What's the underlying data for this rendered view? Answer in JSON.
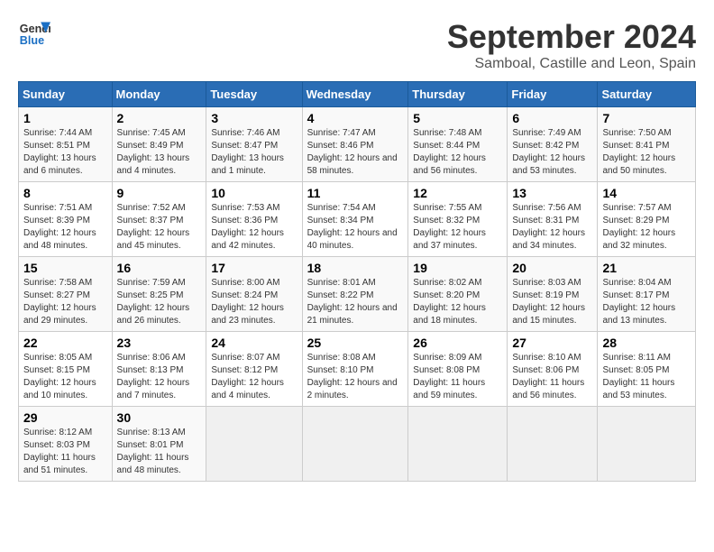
{
  "logo": {
    "line1": "General",
    "line2": "Blue"
  },
  "title": "September 2024",
  "subtitle": "Samboal, Castille and Leon, Spain",
  "weekdays": [
    "Sunday",
    "Monday",
    "Tuesday",
    "Wednesday",
    "Thursday",
    "Friday",
    "Saturday"
  ],
  "weeks": [
    [
      {
        "day": "1",
        "sunrise": "7:44 AM",
        "sunset": "8:51 PM",
        "daylight": "13 hours and 6 minutes."
      },
      {
        "day": "2",
        "sunrise": "7:45 AM",
        "sunset": "8:49 PM",
        "daylight": "13 hours and 4 minutes."
      },
      {
        "day": "3",
        "sunrise": "7:46 AM",
        "sunset": "8:47 PM",
        "daylight": "13 hours and 1 minute."
      },
      {
        "day": "4",
        "sunrise": "7:47 AM",
        "sunset": "8:46 PM",
        "daylight": "12 hours and 58 minutes."
      },
      {
        "day": "5",
        "sunrise": "7:48 AM",
        "sunset": "8:44 PM",
        "daylight": "12 hours and 56 minutes."
      },
      {
        "day": "6",
        "sunrise": "7:49 AM",
        "sunset": "8:42 PM",
        "daylight": "12 hours and 53 minutes."
      },
      {
        "day": "7",
        "sunrise": "7:50 AM",
        "sunset": "8:41 PM",
        "daylight": "12 hours and 50 minutes."
      }
    ],
    [
      {
        "day": "8",
        "sunrise": "7:51 AM",
        "sunset": "8:39 PM",
        "daylight": "12 hours and 48 minutes."
      },
      {
        "day": "9",
        "sunrise": "7:52 AM",
        "sunset": "8:37 PM",
        "daylight": "12 hours and 45 minutes."
      },
      {
        "day": "10",
        "sunrise": "7:53 AM",
        "sunset": "8:36 PM",
        "daylight": "12 hours and 42 minutes."
      },
      {
        "day": "11",
        "sunrise": "7:54 AM",
        "sunset": "8:34 PM",
        "daylight": "12 hours and 40 minutes."
      },
      {
        "day": "12",
        "sunrise": "7:55 AM",
        "sunset": "8:32 PM",
        "daylight": "12 hours and 37 minutes."
      },
      {
        "day": "13",
        "sunrise": "7:56 AM",
        "sunset": "8:31 PM",
        "daylight": "12 hours and 34 minutes."
      },
      {
        "day": "14",
        "sunrise": "7:57 AM",
        "sunset": "8:29 PM",
        "daylight": "12 hours and 32 minutes."
      }
    ],
    [
      {
        "day": "15",
        "sunrise": "7:58 AM",
        "sunset": "8:27 PM",
        "daylight": "12 hours and 29 minutes."
      },
      {
        "day": "16",
        "sunrise": "7:59 AM",
        "sunset": "8:25 PM",
        "daylight": "12 hours and 26 minutes."
      },
      {
        "day": "17",
        "sunrise": "8:00 AM",
        "sunset": "8:24 PM",
        "daylight": "12 hours and 23 minutes."
      },
      {
        "day": "18",
        "sunrise": "8:01 AM",
        "sunset": "8:22 PM",
        "daylight": "12 hours and 21 minutes."
      },
      {
        "day": "19",
        "sunrise": "8:02 AM",
        "sunset": "8:20 PM",
        "daylight": "12 hours and 18 minutes."
      },
      {
        "day": "20",
        "sunrise": "8:03 AM",
        "sunset": "8:19 PM",
        "daylight": "12 hours and 15 minutes."
      },
      {
        "day": "21",
        "sunrise": "8:04 AM",
        "sunset": "8:17 PM",
        "daylight": "12 hours and 13 minutes."
      }
    ],
    [
      {
        "day": "22",
        "sunrise": "8:05 AM",
        "sunset": "8:15 PM",
        "daylight": "12 hours and 10 minutes."
      },
      {
        "day": "23",
        "sunrise": "8:06 AM",
        "sunset": "8:13 PM",
        "daylight": "12 hours and 7 minutes."
      },
      {
        "day": "24",
        "sunrise": "8:07 AM",
        "sunset": "8:12 PM",
        "daylight": "12 hours and 4 minutes."
      },
      {
        "day": "25",
        "sunrise": "8:08 AM",
        "sunset": "8:10 PM",
        "daylight": "12 hours and 2 minutes."
      },
      {
        "day": "26",
        "sunrise": "8:09 AM",
        "sunset": "8:08 PM",
        "daylight": "11 hours and 59 minutes."
      },
      {
        "day": "27",
        "sunrise": "8:10 AM",
        "sunset": "8:06 PM",
        "daylight": "11 hours and 56 minutes."
      },
      {
        "day": "28",
        "sunrise": "8:11 AM",
        "sunset": "8:05 PM",
        "daylight": "11 hours and 53 minutes."
      }
    ],
    [
      {
        "day": "29",
        "sunrise": "8:12 AM",
        "sunset": "8:03 PM",
        "daylight": "11 hours and 51 minutes."
      },
      {
        "day": "30",
        "sunrise": "8:13 AM",
        "sunset": "8:01 PM",
        "daylight": "11 hours and 48 minutes."
      },
      null,
      null,
      null,
      null,
      null
    ]
  ]
}
